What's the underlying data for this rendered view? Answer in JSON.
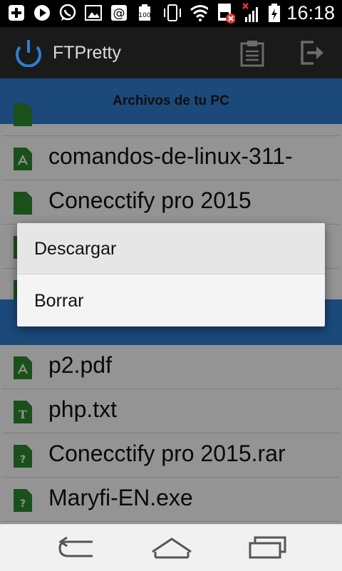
{
  "status_bar": {
    "time": "16:18",
    "icons": [
      "add-icon",
      "play-icon",
      "whatsapp-icon",
      "gallery-icon",
      "at-icon",
      "battery-100-icon",
      "vibrate-icon",
      "wifi-icon",
      "sim-error-icon",
      "signal-off-icon",
      "battery-charging-icon"
    ]
  },
  "app_bar": {
    "title": "FTPretty",
    "actions": [
      "clipboard-icon",
      "logout-icon"
    ]
  },
  "pc_section": {
    "header": "Archivos de tu PC",
    "files": [
      {
        "name": "comandos-de-linux-311-",
        "icon": "pdf-file-icon"
      },
      {
        "name": "Conecctify pro 2015",
        "icon": "folder-icon"
      },
      {
        "name": "",
        "icon": "file-icon"
      },
      {
        "name": "",
        "icon": "file-icon"
      }
    ]
  },
  "phone_section": {
    "header": "",
    "files": [
      {
        "name": "p2.pdf",
        "icon": "pdf-file-icon"
      },
      {
        "name": "php.txt",
        "icon": "text-file-icon"
      },
      {
        "name": "Conecctify pro 2015.rar",
        "icon": "unknown-file-icon"
      },
      {
        "name": "Maryfi-EN.exe",
        "icon": "unknown-file-icon"
      }
    ]
  },
  "context_menu": {
    "items": [
      "Descargar",
      "Borrar"
    ]
  },
  "nav_bar": {
    "buttons": [
      "back-icon",
      "home-icon",
      "recents-icon"
    ]
  },
  "colors": {
    "accent": "#2f7fd3",
    "file_icon": "#2e8b2e",
    "app_bar": "#1a1a1a"
  }
}
